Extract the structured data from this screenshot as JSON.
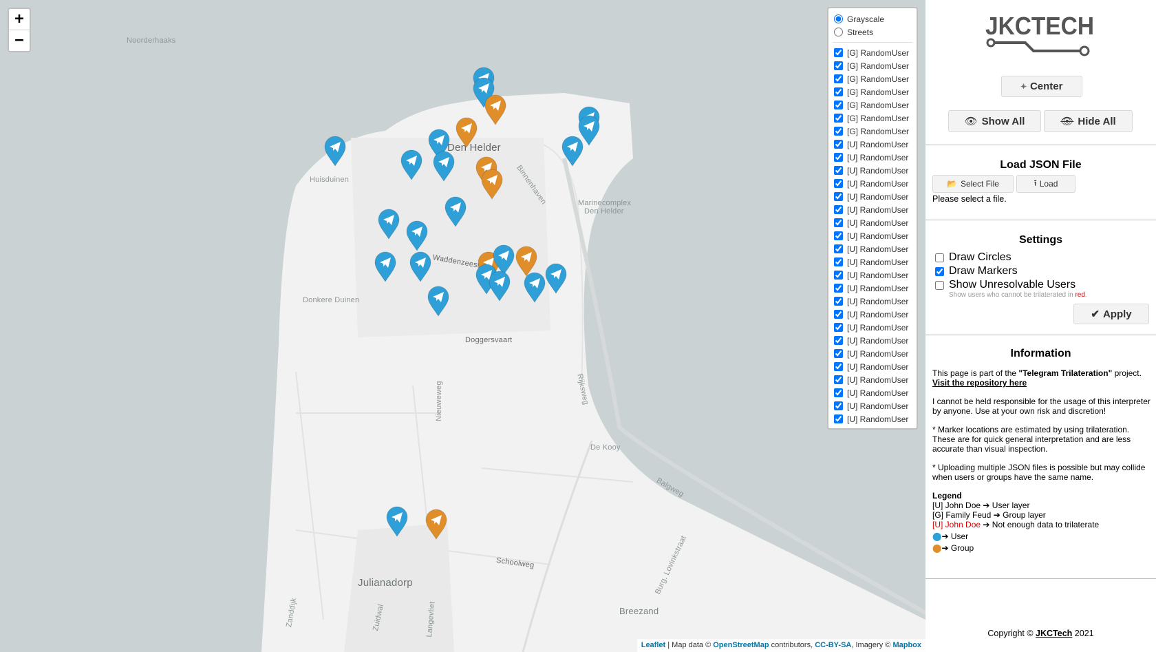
{
  "map": {
    "zoom_in": "+",
    "zoom_out": "−",
    "labels": {
      "noorderhaaks": "Noorderhaaks",
      "den_helder": "Den Helder",
      "huisduinen": "Huisduinen",
      "binnenhaven": "Binnenhaven",
      "marinecomplex_1": "Marinecomplex",
      "marinecomplex_2": "Den Helder",
      "waddenzeestraat": "Waddenzeestraat",
      "donkere_duinen": "Donkere Duinen",
      "doggersvaart": "Doggersvaart",
      "nieuweweg": "Nieuweweg",
      "rijksweg": "Rijksweg",
      "de_kooy": "De Kooy",
      "balgweg": "Balgweg",
      "schoolweg": "Schoolweg",
      "burg_lovinkstraat": "Burg. Lovinkstraat",
      "julianadorp": "Julianadorp",
      "breezand": "Breezand",
      "zanddijk": "Zanddijk",
      "zuidwal": "Zuidwal",
      "langevliet": "Langevliet",
      "rijksweg_2": "Rijksweg"
    },
    "attribution": {
      "leaflet": "Leaflet",
      "mid1": " | Map data © ",
      "osm": "OpenStreetMap",
      "mid2": " contributors, ",
      "ccbysa": "CC-BY-SA",
      "mid3": ", Imagery © ",
      "mapbox": "Mapbox"
    },
    "colors": {
      "user_marker": "#2f9fd8",
      "group_marker": "#e08e2a",
      "water": "#cad2d3",
      "land": "#f2f2f2"
    }
  },
  "layer_control": {
    "base_layers": [
      {
        "label": "Grayscale",
        "selected": true
      },
      {
        "label": "Streets",
        "selected": false
      }
    ],
    "overlays": [
      "[G] RandomUser",
      "[G] RandomUser",
      "[G] RandomUser",
      "[G] RandomUser",
      "[G] RandomUser",
      "[G] RandomUser",
      "[G] RandomUser",
      "[U] RandomUser",
      "[U] RandomUser",
      "[U] RandomUser",
      "[U] RandomUser",
      "[U] RandomUser",
      "[U] RandomUser",
      "[U] RandomUser",
      "[U] RandomUser",
      "[U] RandomUser",
      "[U] RandomUser",
      "[U] RandomUser",
      "[U] RandomUser",
      "[U] RandomUser",
      "[U] RandomUser",
      "[U] RandomUser",
      "[U] RandomUser",
      "[U] RandomUser",
      "[U] RandomUser",
      "[U] RandomUser",
      "[U] RandomUser",
      "[U] RandomUser",
      "[U] RandomUser"
    ]
  },
  "panel": {
    "logo_text": "JKCTECH",
    "center_label": "Center",
    "show_all_label": "Show All",
    "hide_all_label": "Hide All",
    "load_title": "Load JSON File",
    "select_file_label": "Select File",
    "load_label": "Load",
    "file_status": "Please select a file.",
    "settings_title": "Settings",
    "draw_circles": "Draw Circles",
    "draw_markers": "Draw Markers",
    "show_unresolvable": "Show Unresolvable Users",
    "unresolvable_hint": "Show users who cannot be trilaterated in",
    "unresolvable_hint_red": "red",
    "unresolvable_hint_end": ".",
    "apply_label": "Apply",
    "info_title": "Information",
    "info_p1_a": "This page is part of the ",
    "info_p1_b": "\"Telegram Trilateration\"",
    "info_p1_c": " project.",
    "info_link": "Visit the repository here",
    "info_p2": "I cannot be held responsible for the usage of this interpreter by anyone. Use at your own risk and discretion!",
    "info_p3": "* Marker locations are estimated by using trilateration. These are for quick general interpretation and are less accurate than visual inspection.",
    "info_p4": "* Uploading multiple JSON files is possible but may collide when users or groups have the same name.",
    "legend_title": "Legend",
    "legend_user_prefix": "[U] John Doe",
    "legend_user_text": "User layer",
    "legend_group_prefix": "[G] Family Feud",
    "legend_group_text": "Group layer",
    "legend_red_prefix": "[U] John Doe",
    "legend_red_text": "Not enough data to trilaterate",
    "legend_user_marker": "User",
    "legend_group_marker": "Group",
    "copyright_a": "Copyright © ",
    "copyright_link": "JKCTech",
    "copyright_b": " 2021"
  }
}
